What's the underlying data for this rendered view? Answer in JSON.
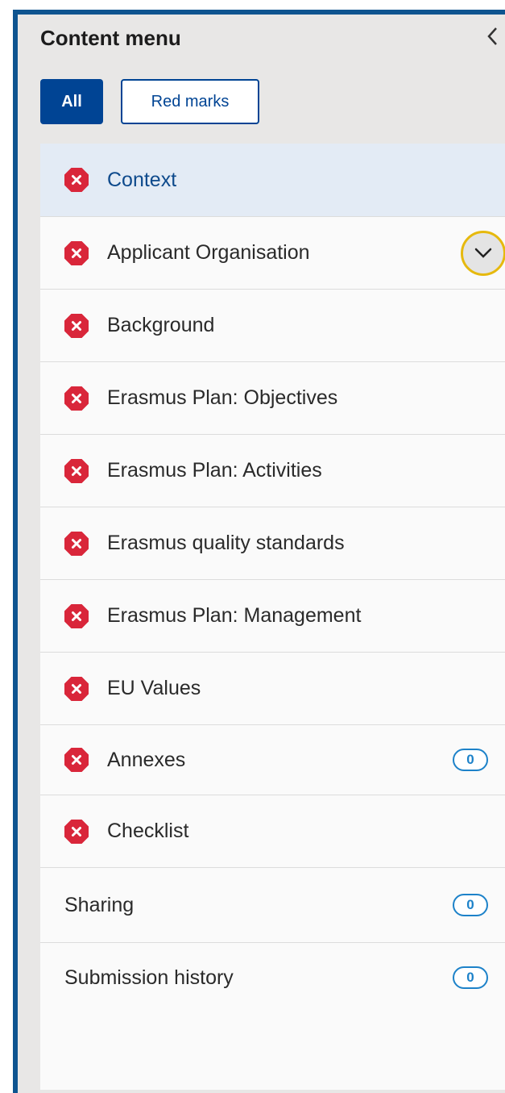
{
  "menu": {
    "title": "Content menu",
    "collapse_icon": "chevron-left-icon",
    "filters": {
      "all_label": "All",
      "red_marks_label": "Red marks",
      "active": "All"
    },
    "colors": {
      "accent": "#004494",
      "error": "#d9263a",
      "badge": "#1d82c9",
      "focus_ring": "#e6b90e",
      "frame": "#0e5490"
    },
    "items": [
      {
        "label": "Context",
        "status_icon": "error-icon",
        "active": true
      },
      {
        "label": "Applicant Organisation",
        "status_icon": "error-icon",
        "expand_icon": "chevron-down-icon"
      },
      {
        "label": "Background",
        "status_icon": "error-icon"
      },
      {
        "label": "Erasmus Plan: Objectives",
        "status_icon": "error-icon"
      },
      {
        "label": "Erasmus Plan: Activities",
        "status_icon": "error-icon"
      },
      {
        "label": "Erasmus quality standards",
        "status_icon": "error-icon"
      },
      {
        "label": "Erasmus Plan: Management",
        "status_icon": "error-icon"
      },
      {
        "label": "EU Values",
        "status_icon": "error-icon"
      },
      {
        "label": "Annexes",
        "status_icon": "error-icon",
        "count": "0"
      },
      {
        "label": "Checklist",
        "status_icon": "error-icon"
      },
      {
        "label": "Sharing",
        "count": "0"
      },
      {
        "label": "Submission history",
        "count": "0"
      }
    ]
  }
}
